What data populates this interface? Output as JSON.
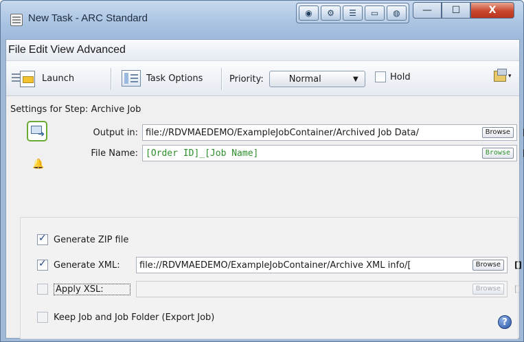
{
  "window": {
    "title": "New Task - ARC Standard"
  },
  "titlebar_tools": [
    "monitor-icon",
    "settings-icon",
    "sliders-icon",
    "panel-icon",
    "globe-icon"
  ],
  "window_controls": {
    "minimize": "—",
    "maximize": "☐",
    "close": "X"
  },
  "menubar": {
    "items": [
      "File",
      "Edit",
      "View",
      "Advanced"
    ]
  },
  "toolbar": {
    "launch_label": "Launch",
    "task_options_label": "Task Options",
    "priority_label": "Priority:",
    "priority_value": "Normal",
    "hold_label": "Hold",
    "hold_checked": false
  },
  "step": {
    "heading": "Settings for Step: Archive Job",
    "output_label": "Output in:",
    "output_value": "file://RDVMAEDEMO/ExampleJobContainer/Archived Job Data/",
    "file_name_label": "File Name:",
    "file_name_value": "[Order ID]_[Job Name]",
    "browse_label": "Browse",
    "brackets_label": "[]"
  },
  "options": {
    "generate_zip": {
      "label": "Generate ZIP file",
      "checked": true
    },
    "generate_xml": {
      "label": "Generate XML:",
      "checked": true,
      "value": "file://RDVMAEDEMO/ExampleJobContainer/Archive XML info/["
    },
    "apply_xsl": {
      "label": "Apply XSL:",
      "checked": false,
      "value": ""
    },
    "keep_job": {
      "label": "Keep Job and Job Folder (Export Job)",
      "checked": false
    }
  },
  "help": {
    "symbol": "?"
  },
  "colors": {
    "title_bar": "#a9c3e2",
    "close_button": "#c9462c",
    "template_text": "#2c8f2a",
    "step_icon_border": "#6aaa33"
  }
}
